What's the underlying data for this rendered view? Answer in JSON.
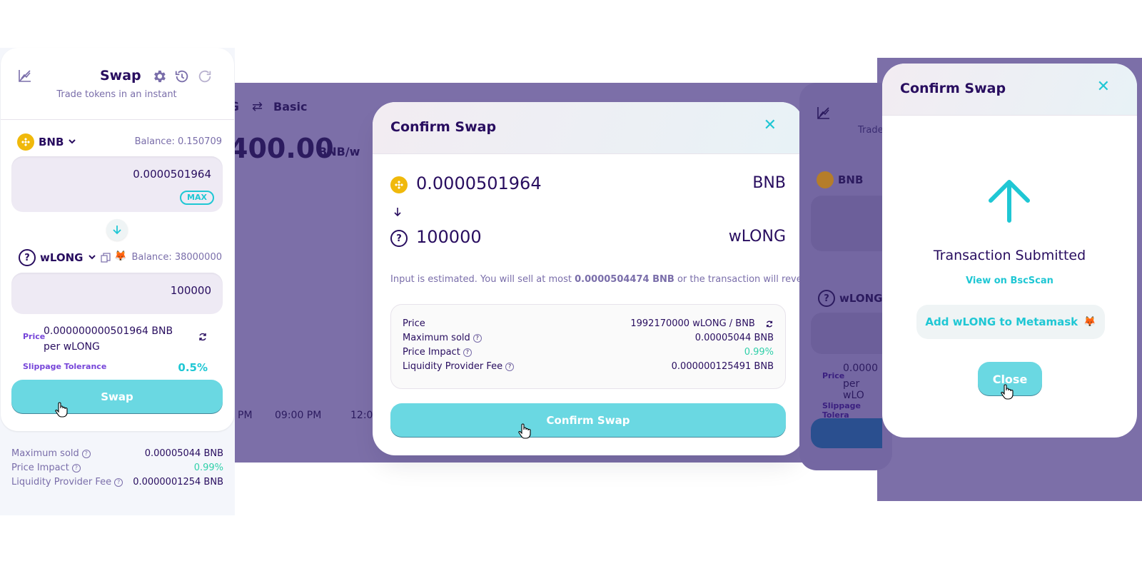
{
  "panel1": {
    "title": "Swap",
    "subtitle": "Trade tokens in an instant",
    "from": {
      "symbol": "BNB",
      "balance": "Balance: 0.150709",
      "value": "0.0000501964",
      "max_label": "MAX"
    },
    "to": {
      "symbol": "wLONG",
      "balance": "Balance: 38000000",
      "value": "100000"
    },
    "price_label": "Price",
    "price_value": "0.000000000501964 BNB per wLONG",
    "slippage_label": "Slippage Tolerance",
    "slippage_value": "0.5%",
    "swap_button": "Swap",
    "details": [
      {
        "label": "Maximum sold",
        "value": "0.00005044 BNB"
      },
      {
        "label": "Price Impact",
        "value": "0.99%"
      },
      {
        "label": "Liquidity Provider Fee",
        "value": "0.0000001254 BNB"
      }
    ]
  },
  "background": {
    "pair_fragment": "G",
    "basic_label": "Basic",
    "big_price": "400.00",
    "pair_unit": "BNB/w",
    "time_labels": [
      "PM",
      "09:00 PM",
      "12:0"
    ]
  },
  "modal": {
    "title": "Confirm Swap",
    "input_value": "0.0000501964",
    "input_symbol": "BNB",
    "output_value": "100000",
    "output_symbol": "wLONG",
    "note_prefix": "Input is estimated. You will sell at most",
    "note_amount": "0.0000504474 BNB",
    "note_suffix": "or the transaction will revert.",
    "rows": [
      {
        "label": "Price",
        "value": "1992170000 wLONG / BNB"
      },
      {
        "label": "Maximum sold",
        "value": "0.00005044 BNB"
      },
      {
        "label": "Price Impact",
        "value": "0.99%"
      },
      {
        "label": "Liquidity Provider Fee",
        "value": "0.000000125491 BNB"
      }
    ],
    "confirm_button": "Confirm Swap"
  },
  "panel3": {
    "title": "Confirm Swap",
    "status": "Transaction Submitted",
    "view_link": "View on BscScan",
    "add_token": "Add wLONG to Metamask",
    "close_button": "Close",
    "behind": {
      "subtitle_fragment": "Trade",
      "from_symbol": "BNB",
      "to_symbol": "wLONG",
      "price_label": "Price",
      "price_fragment": "0.0000",
      "price_fragment2": "per wLO",
      "slippage_fragment": "Slippage Tolera"
    }
  },
  "colors": {
    "accent": "#1fc7d4",
    "text": "#280d5f",
    "secondary": "#7a6eaa",
    "success": "#31d0aa",
    "button_disabled": "#6ad8e2",
    "overlay": "#7c6fa8"
  }
}
